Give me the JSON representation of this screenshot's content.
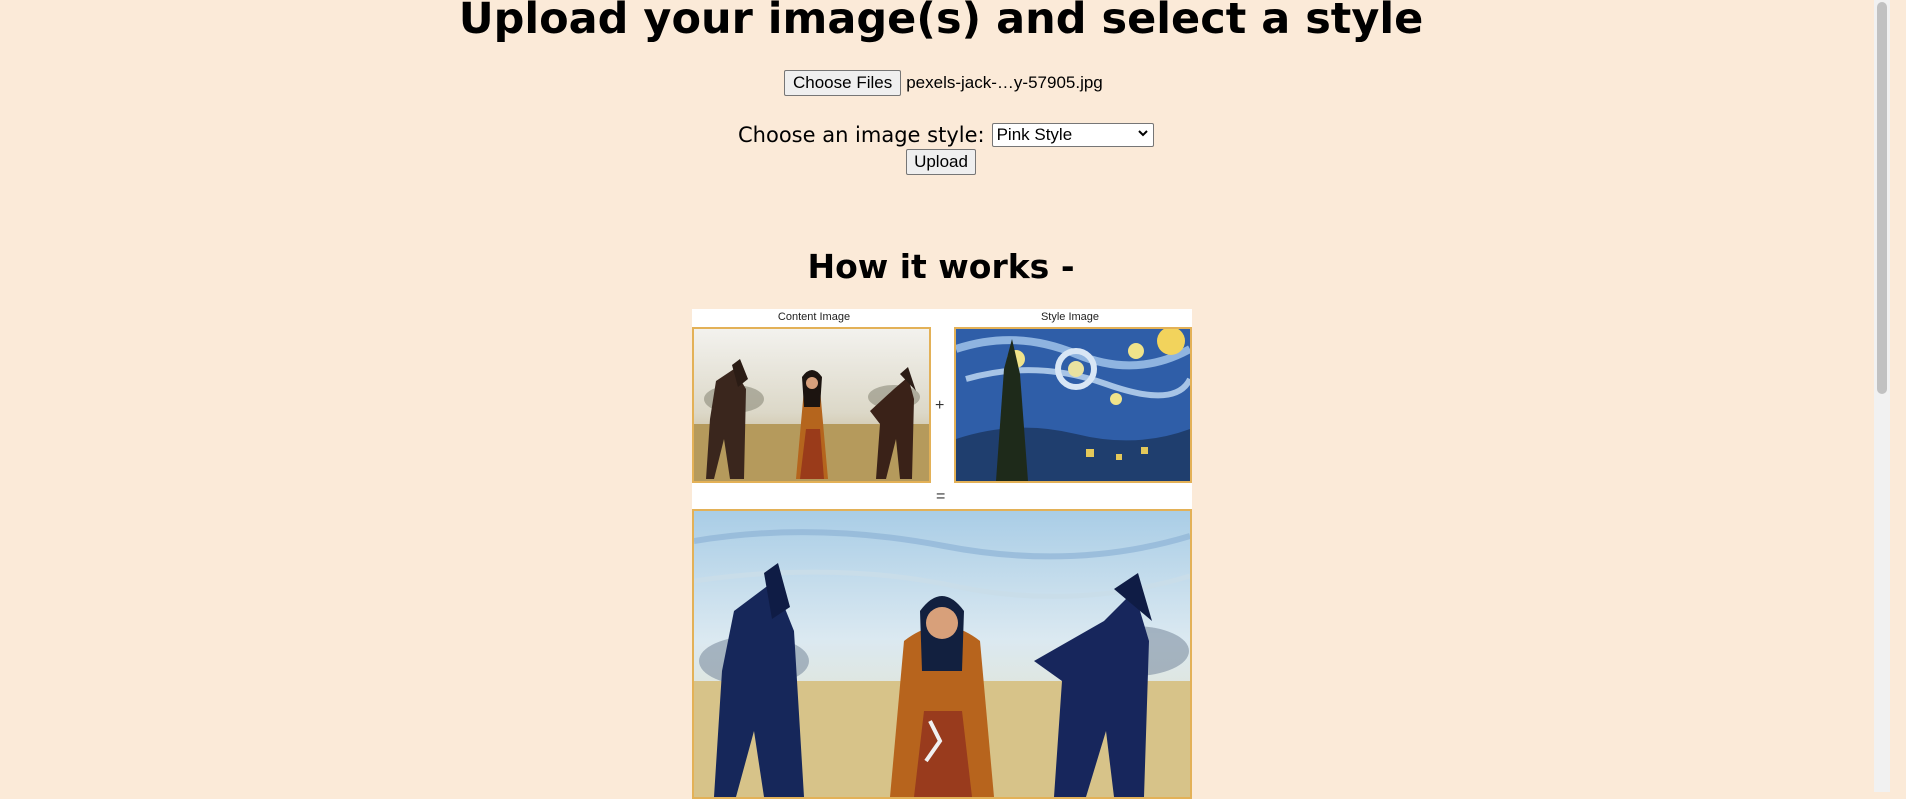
{
  "header": {
    "title": "Upload your image(s) and select a style"
  },
  "upload_form": {
    "choose_files_label": "Choose Files",
    "selected_file_name": "pexels-jack-…y-57905.jpg",
    "style_label": "Choose an image style:",
    "style_selected": "Pink Style",
    "upload_label": "Upload"
  },
  "how_it_works": {
    "heading": "How it works -",
    "content_caption": "Content Image",
    "style_caption": "Style Image",
    "plus_symbol": "+",
    "equals_symbol": "="
  },
  "icons": {
    "select_arrow": "chevron-down-icon"
  },
  "colors": {
    "page_background": "#fbead8",
    "image_border": "#e3b157"
  }
}
